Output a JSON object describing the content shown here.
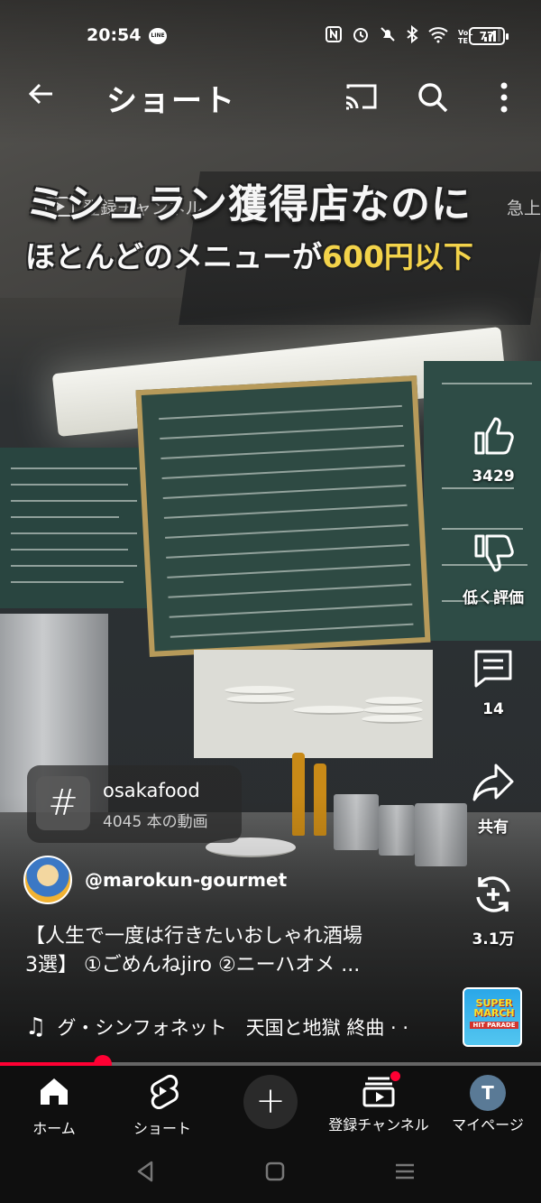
{
  "status_bar": {
    "time": "20:54",
    "line_badge": "LINE",
    "network": "VoLTE",
    "battery": "77"
  },
  "appbar": {
    "title": "ショート"
  },
  "overlay_caption": {
    "line1": "ミシュラン獲得店なのに",
    "line2_prefix": "ほとんどのメニューが",
    "line2_highlight": "600円以下"
  },
  "ghost_header": {
    "label": "登録チャンネル",
    "right_label": "急上"
  },
  "actions": {
    "like_count": "3429",
    "dislike_label": "低く評価",
    "comment_count": "14",
    "share_label": "共有",
    "remix_count": "3.1万"
  },
  "hashtag_chip": {
    "tag": "osakafood",
    "count": "4045 本の動画"
  },
  "channel": {
    "handle": "@marokun-gourmet"
  },
  "description": {
    "line1": "【人生で一度は行きたいおしゃれ酒場",
    "line2": "3選】 ①ごめんねjiro ②ニーハオメ ..."
  },
  "music": {
    "text": "グ・シンフォネット　天国と地獄 終曲 · ·"
  },
  "album_art": {
    "line1": "SUPER MARCH",
    "line2": "HIT PARADE"
  },
  "progress": {
    "fraction": 0.19
  },
  "bottom_nav": {
    "home": "ホーム",
    "shorts": "ショート",
    "subscriptions": "登録チャンネル",
    "mypage": "マイページ",
    "avatar_initial": "T"
  },
  "colors": {
    "accent": "#ff0033",
    "highlight": "#f3d34a",
    "background": "#0f0f0f"
  }
}
